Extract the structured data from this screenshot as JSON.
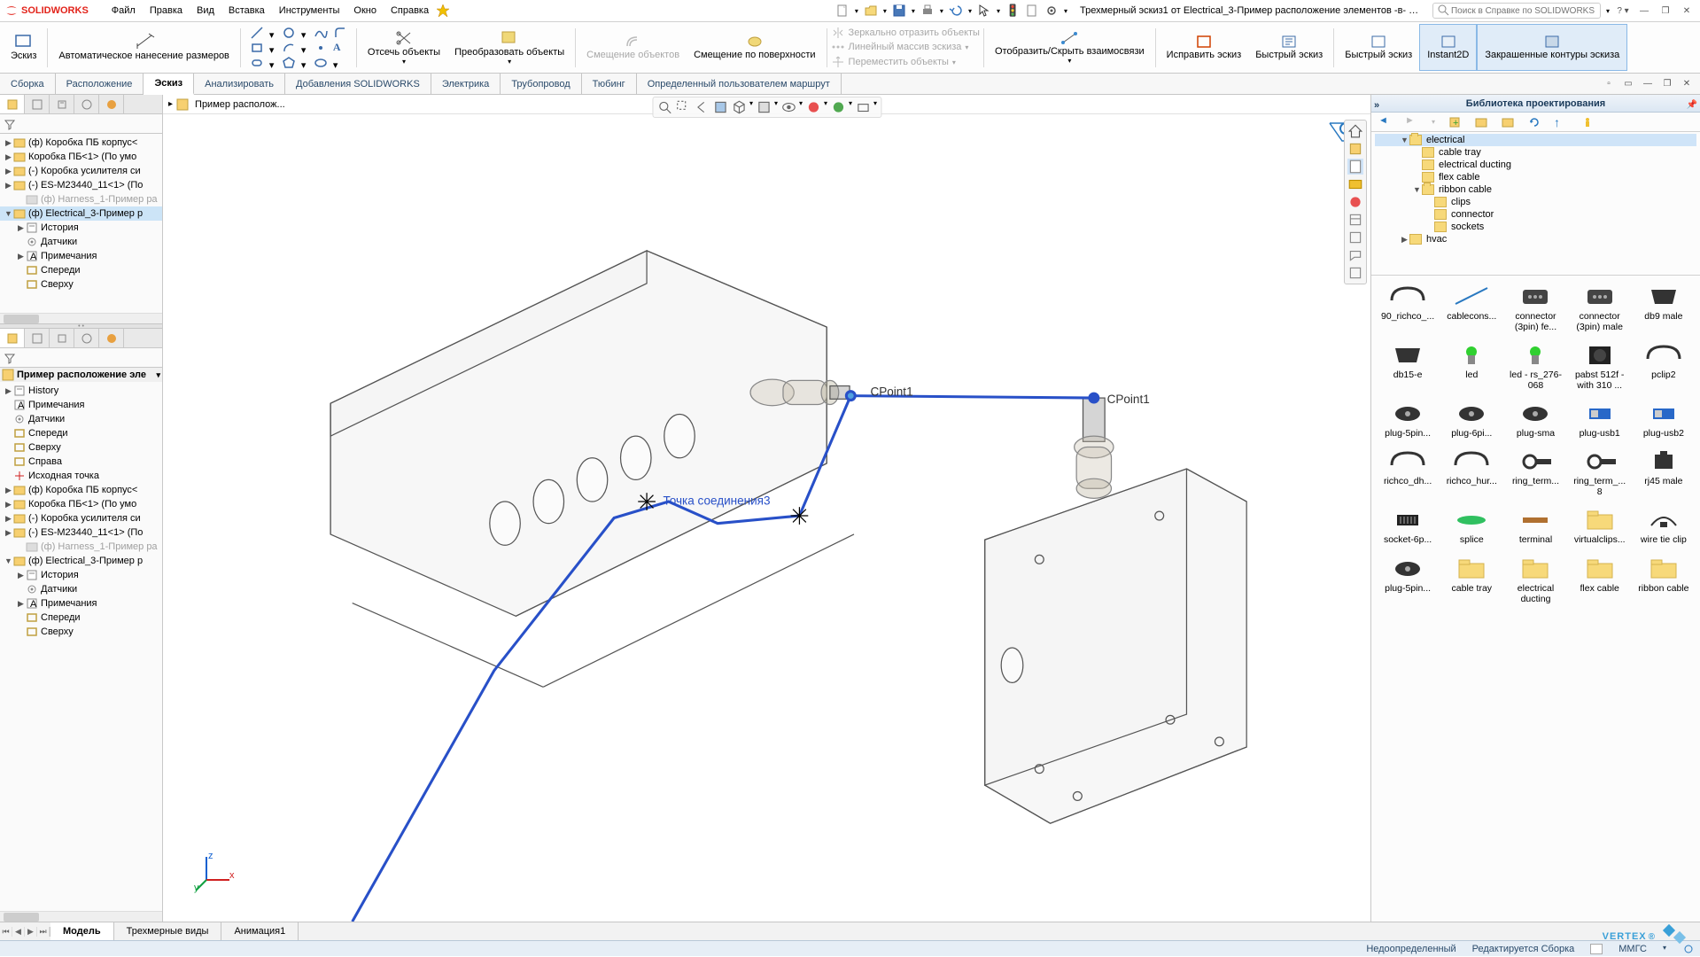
{
  "app": {
    "logo": "SOLIDWORKS"
  },
  "menu": [
    "Файл",
    "Правка",
    "Вид",
    "Вставка",
    "Инструменты",
    "Окно",
    "Справка"
  ],
  "doc_title": "Трехмерный эскиз1 от Electrical_3-Пример расположение элементов -в- Прим...",
  "search_placeholder": "Поиск в Справке по SOLIDWORKS",
  "ribbon": {
    "sketch": "Эскиз",
    "smartdim": "Автоматическое нанесение размеров",
    "trim": "Отсечь объекты",
    "convert": "Преобразовать объекты",
    "offset": "Смещение объектов",
    "offset_surface": "Смещение по поверхности",
    "mirror": "Зеркально отразить объекты",
    "linear": "Линейный массив эскиза",
    "move": "Переместить объекты",
    "show_rel": "Отобразить/Скрыть взаимосвязи",
    "repair": "Исправить эскиз",
    "rapid": "Быстрый эскиз",
    "rapid2": "Быстрый эскиз",
    "instant2d": "Instant2D",
    "shaded": "Закрашенные контуры эскиза"
  },
  "tabs": [
    "Сборка",
    "Расположение",
    "Эскиз",
    "Анализировать",
    "Добавления SOLIDWORKS",
    "Электрика",
    "Трубопровод",
    "Тюбинг",
    "Определенный пользователем маршрут"
  ],
  "active_tab": 2,
  "breadcrumb": "Пример располож...",
  "tree_top": [
    {
      "ind": 0,
      "exp": "▶",
      "icon": "comp",
      "text": "(ф) Коробка ПБ корпус<"
    },
    {
      "ind": 0,
      "exp": "▶",
      "icon": "comp",
      "text": "Коробка ПБ<1> (По умо"
    },
    {
      "ind": 0,
      "exp": "▶",
      "icon": "comp",
      "text": "(-) Коробка усилителя си"
    },
    {
      "ind": 0,
      "exp": "▶",
      "icon": "comp",
      "text": "(-) ES-M23440_11<1> (По"
    },
    {
      "ind": 1,
      "exp": "",
      "icon": "comp_dim",
      "text": "(ф) Harness_1-Пример ра",
      "dim": true
    },
    {
      "ind": 0,
      "exp": "▼",
      "icon": "comp_sel",
      "text": "(ф) Electrical_3-Пример р",
      "sel": true
    },
    {
      "ind": 1,
      "exp": "▶",
      "icon": "hist",
      "text": "История"
    },
    {
      "ind": 1,
      "exp": "",
      "icon": "sens",
      "text": "Датчики"
    },
    {
      "ind": 1,
      "exp": "▶",
      "icon": "note",
      "text": "Примечания"
    },
    {
      "ind": 1,
      "exp": "",
      "icon": "plane",
      "text": "Спереди"
    },
    {
      "ind": 1,
      "exp": "",
      "icon": "plane",
      "text": "Сверху"
    }
  ],
  "tree_bot_title": "Пример расположение эле",
  "tree_bot": [
    {
      "ind": 0,
      "exp": "▶",
      "icon": "hist",
      "text": "History"
    },
    {
      "ind": 0,
      "exp": "",
      "icon": "note",
      "text": "Примечания"
    },
    {
      "ind": 0,
      "exp": "",
      "icon": "sens",
      "text": "Датчики"
    },
    {
      "ind": 0,
      "exp": "",
      "icon": "plane",
      "text": "Спереди"
    },
    {
      "ind": 0,
      "exp": "",
      "icon": "plane",
      "text": "Сверху"
    },
    {
      "ind": 0,
      "exp": "",
      "icon": "plane",
      "text": "Справа"
    },
    {
      "ind": 0,
      "exp": "",
      "icon": "origin",
      "text": "Исходная точка"
    },
    {
      "ind": 0,
      "exp": "▶",
      "icon": "comp",
      "text": "(ф) Коробка ПБ корпус<"
    },
    {
      "ind": 0,
      "exp": "▶",
      "icon": "comp",
      "text": "Коробка ПБ<1> (По умо"
    },
    {
      "ind": 0,
      "exp": "▶",
      "icon": "comp",
      "text": "(-) Коробка усилителя си"
    },
    {
      "ind": 0,
      "exp": "▶",
      "icon": "comp",
      "text": "(-) ES-M23440_11<1> (По"
    },
    {
      "ind": 1,
      "exp": "",
      "icon": "comp_dim",
      "text": "(ф) Harness_1-Пример ра",
      "dim": true
    },
    {
      "ind": 0,
      "exp": "▼",
      "icon": "comp_sel",
      "text": "(ф) Electrical_3-Пример р"
    },
    {
      "ind": 1,
      "exp": "▶",
      "icon": "hist",
      "text": "История"
    },
    {
      "ind": 1,
      "exp": "",
      "icon": "sens",
      "text": "Датчики"
    },
    {
      "ind": 1,
      "exp": "▶",
      "icon": "note",
      "text": "Примечания"
    },
    {
      "ind": 1,
      "exp": "",
      "icon": "plane",
      "text": "Спереди"
    },
    {
      "ind": 1,
      "exp": "",
      "icon": "plane",
      "text": "Сверху"
    }
  ],
  "library": {
    "title": "Библиотека проектирования",
    "tree": [
      {
        "ind": 2,
        "exp": "▼",
        "text": "electrical",
        "open": true,
        "sel": true
      },
      {
        "ind": 3,
        "exp": "",
        "text": "cable tray"
      },
      {
        "ind": 3,
        "exp": "",
        "text": "electrical ducting"
      },
      {
        "ind": 3,
        "exp": "",
        "text": "flex cable"
      },
      {
        "ind": 3,
        "exp": "▼",
        "text": "ribbon cable",
        "open": true
      },
      {
        "ind": 4,
        "exp": "",
        "text": "clips"
      },
      {
        "ind": 4,
        "exp": "",
        "text": "connector"
      },
      {
        "ind": 4,
        "exp": "",
        "text": "sockets"
      },
      {
        "ind": 2,
        "exp": "▶",
        "text": "hvac"
      }
    ],
    "items": [
      {
        "label": "90_richco_...",
        "shape": "clip"
      },
      {
        "label": "cablecons...",
        "shape": "line"
      },
      {
        "label": "connector (3pin) fe...",
        "shape": "conn"
      },
      {
        "label": "connector (3pin) male",
        "shape": "conn"
      },
      {
        "label": "db9 male",
        "shape": "db"
      },
      {
        "label": "db15-e",
        "shape": "db"
      },
      {
        "label": "led",
        "shape": "led"
      },
      {
        "label": "led - rs_276-068",
        "shape": "led"
      },
      {
        "label": "pabst 512f - with 310 ...",
        "shape": "fan"
      },
      {
        "label": "pclip2",
        "shape": "clip"
      },
      {
        "label": "plug-5pin...",
        "shape": "plug"
      },
      {
        "label": "plug-6pi...",
        "shape": "plug"
      },
      {
        "label": "plug-sma",
        "shape": "plug"
      },
      {
        "label": "plug-usb1",
        "shape": "usb"
      },
      {
        "label": "plug-usb2",
        "shape": "usb"
      },
      {
        "label": "richco_dh...",
        "shape": "clip"
      },
      {
        "label": "richco_hur...",
        "shape": "clip"
      },
      {
        "label": "ring_term...",
        "shape": "ring"
      },
      {
        "label": "ring_term_... 8",
        "shape": "ring"
      },
      {
        "label": "rj45 male",
        "shape": "rj"
      },
      {
        "label": "socket-6p...",
        "shape": "sock"
      },
      {
        "label": "splice",
        "shape": "splice"
      },
      {
        "label": "terminal",
        "shape": "term"
      },
      {
        "label": "virtualclips...",
        "shape": "folder"
      },
      {
        "label": "wire tie clip",
        "shape": "tie"
      },
      {
        "label": "plug-5pin...",
        "shape": "plug"
      },
      {
        "label": "cable tray",
        "shape": "folder"
      },
      {
        "label": "electrical ducting",
        "shape": "folder"
      },
      {
        "label": "flex cable",
        "shape": "folder"
      },
      {
        "label": "ribbon cable",
        "shape": "folder"
      }
    ]
  },
  "bottom_tabs": [
    "Модель",
    "Трехмерные виды",
    "Анимация1"
  ],
  "canvas_labels": {
    "p1": "CPoint1",
    "p2": "CPoint1",
    "link": "Точка соединения3"
  },
  "status": {
    "left": "",
    "r1": "Недоопределенный",
    "r2": "Редактируется Сборка",
    "r3": "ММГС"
  },
  "vertex": "VERTEX"
}
